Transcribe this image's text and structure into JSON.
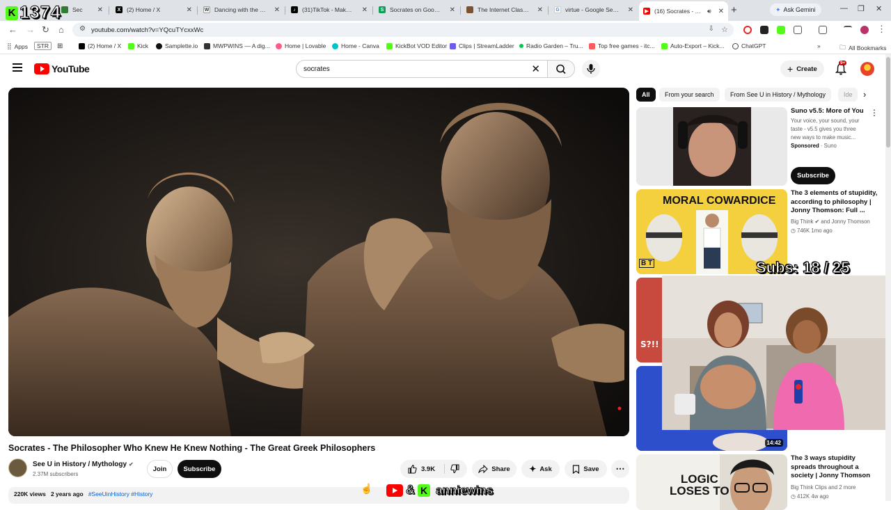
{
  "browser": {
    "tabs": [
      {
        "title": "Sec",
        "color": "#2e7d32"
      },
      {
        "title": "(2) Home / X",
        "color": "#000000"
      },
      {
        "title": "Dancing with the Stars",
        "color": "#636466"
      },
      {
        "title": "(31)TikTok - Make Your",
        "color": "#000000"
      },
      {
        "title": "Socrates on Goodness",
        "color": "#0f9d58"
      },
      {
        "title": "The Internet Classics A",
        "color": "#7a5230"
      },
      {
        "title": "virtue - Google Search",
        "color": "#4285f4"
      },
      {
        "title": "(16) Socrates - The",
        "color": "#ff0000"
      }
    ],
    "ask_gemini": "Ask Gemini",
    "url": "youtube.com/watch?v=YQcuTYcxxWc",
    "bookmarks": [
      {
        "label": "Apps",
        "color": "#5f6368"
      },
      {
        "label": "STR",
        "color": "#ffffff"
      },
      {
        "label": "(2) Home / X",
        "color": "#000000"
      },
      {
        "label": "Kick",
        "color": "#53fc18"
      },
      {
        "label": "Samplette.io",
        "color": "#111111"
      },
      {
        "label": "MWPWINS — A dig...",
        "color": "#333333"
      },
      {
        "label": "Home | Lovable",
        "color": "#ff5a8a"
      },
      {
        "label": "Home - Canva",
        "color": "#00c4cc"
      },
      {
        "label": "KickBot VOD Editor",
        "color": "#53fc18"
      },
      {
        "label": "Clips | StreamLadder",
        "color": "#6c5ce7"
      },
      {
        "label": "Radio Garden – Tru...",
        "color": "#00c853"
      },
      {
        "label": "Top free games - itc...",
        "color": "#fa5c5c"
      },
      {
        "label": "Auto-Export – Kick...",
        "color": "#53fc18"
      },
      {
        "label": "ChatGPT",
        "color": "#444444"
      }
    ],
    "all_bookmarks": "All Bookmarks"
  },
  "youtube": {
    "logo_text": "YouTube",
    "search_query": "socrates",
    "create_label": "Create",
    "notification_badge": "9+",
    "video": {
      "title": "Socrates - The Philosopher Who Knew He Knew Nothing - The Great Greek Philosophers",
      "channel": "See U in History / Mythology",
      "subscribers": "2.37M subscribers",
      "join": "Join",
      "subscribe": "Subscribe",
      "likes": "3.9K",
      "share": "Share",
      "ask": "Ask",
      "save": "Save",
      "views": "220K views",
      "age": "2 years ago",
      "hashtags": "#SeeUinHistory #History"
    },
    "chips": [
      "All",
      "From your search",
      "From See U in History / Mythology",
      "Ide"
    ],
    "recommendations": [
      {
        "title": "Suno v5.5: More of You",
        "desc": "Your voice, your sound, your taste - v5.5 gives you three new ways to make music...",
        "sponsored": "Sponsored",
        "advertiser": "Suno",
        "cta": "Subscribe"
      },
      {
        "thumb_text": "MORAL COWARDICE",
        "thumb_badge": "B T",
        "title": "The 3 elements of stupidity, according to philosophy | Jonny Thomson: Full ...",
        "channel": "Big Think",
        "channel_extra": "and Jonny Thomson",
        "views": "746K",
        "age": "1mo ago"
      },
      {
        "duration": "14:42"
      },
      {
        "thumb_text_1": "LOGIC",
        "thumb_text_2": "LOSES TO",
        "title": "The 3 ways stupidity spreads throughout a society | Jonny Thomson",
        "channel": "Big Think Clips",
        "channel_extra": "and 2 more",
        "views": "412K",
        "age": "4w ago"
      }
    ]
  },
  "overlay": {
    "counter": "1374",
    "counter_badge": "K",
    "subs": "Subs: 18 / 25",
    "handle_amp": "&",
    "handle_badge": "K",
    "handle": "anniewins"
  }
}
